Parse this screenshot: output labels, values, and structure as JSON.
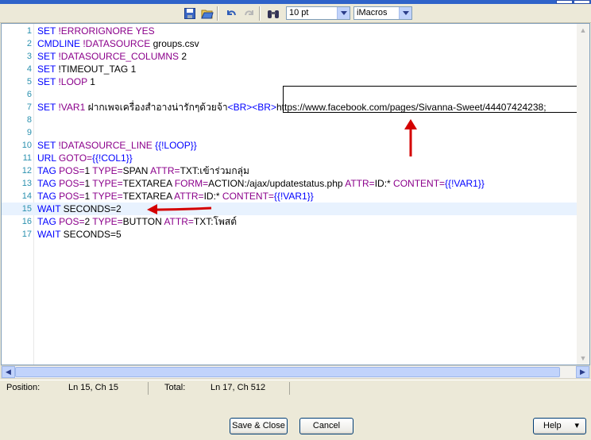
{
  "toolbar": {
    "font_size": "10 pt",
    "syntax": "iMacros"
  },
  "editor": {
    "lines": [
      {
        "n": "1",
        "parts": [
          [
            "kw",
            "SET "
          ],
          [
            "prm",
            "!ERRORIGNORE "
          ],
          [
            "prm",
            "YES"
          ]
        ]
      },
      {
        "n": "2",
        "parts": [
          [
            "kw",
            "CMDLINE "
          ],
          [
            "prm",
            "!DATASOURCE "
          ],
          [
            "tx",
            "groups.csv"
          ]
        ]
      },
      {
        "n": "3",
        "parts": [
          [
            "kw",
            "SET "
          ],
          [
            "prm",
            "!DATASOURCE_COLUMNS "
          ],
          [
            "tx",
            "2"
          ]
        ]
      },
      {
        "n": "4",
        "parts": [
          [
            "kw",
            "SET "
          ],
          [
            "tx",
            "!TIMEOUT_TAG 1"
          ]
        ]
      },
      {
        "n": "5",
        "parts": [
          [
            "kw",
            "SET "
          ],
          [
            "prm",
            "!LOOP "
          ],
          [
            "tx",
            "1"
          ]
        ]
      },
      {
        "n": "6",
        "parts": []
      },
      {
        "n": "7",
        "parts": [
          [
            "kw",
            "SET "
          ],
          [
            "prm",
            "!VAR1 "
          ],
          [
            "tx",
            "ฝากเพจเครื่องสำอางน่ารักๆด้วยจ้า"
          ],
          [
            "var",
            "<BR><BR>"
          ],
          [
            "tx",
            "https://www.facebook.com/pages/Sivanna-Sweet/44407424238;"
          ]
        ]
      },
      {
        "n": "8",
        "parts": []
      },
      {
        "n": "9",
        "parts": []
      },
      {
        "n": "10",
        "parts": [
          [
            "kw",
            "SET "
          ],
          [
            "prm",
            "!DATASOURCE_LINE "
          ],
          [
            "var",
            "{{!LOOP}}"
          ]
        ]
      },
      {
        "n": "11",
        "parts": [
          [
            "kw",
            "URL "
          ],
          [
            "prm",
            "GOTO="
          ],
          [
            "var",
            "{{!COL1}}"
          ]
        ]
      },
      {
        "n": "12",
        "parts": [
          [
            "kw",
            "TAG "
          ],
          [
            "prm",
            "POS="
          ],
          [
            "tx",
            "1 "
          ],
          [
            "prm",
            "TYPE="
          ],
          [
            "tx",
            "SPAN "
          ],
          [
            "prm",
            "ATTR="
          ],
          [
            "tx",
            "TXT:เข้าร่วมกลุ่ม"
          ]
        ]
      },
      {
        "n": "13",
        "parts": [
          [
            "kw",
            "TAG "
          ],
          [
            "prm",
            "POS="
          ],
          [
            "tx",
            "1 "
          ],
          [
            "prm",
            "TYPE="
          ],
          [
            "tx",
            "TEXTAREA "
          ],
          [
            "prm",
            "FORM="
          ],
          [
            "tx",
            "ACTION:/ajax/updatestatus.php "
          ],
          [
            "prm",
            "ATTR="
          ],
          [
            "tx",
            "ID:* "
          ],
          [
            "prm",
            "CONTENT="
          ],
          [
            "var",
            "{{!VAR1}}"
          ]
        ]
      },
      {
        "n": "14",
        "parts": [
          [
            "kw",
            "TAG "
          ],
          [
            "prm",
            "POS="
          ],
          [
            "tx",
            "1 "
          ],
          [
            "prm",
            "TYPE="
          ],
          [
            "tx",
            "TEXTAREA "
          ],
          [
            "prm",
            "ATTR="
          ],
          [
            "tx",
            "ID:* "
          ],
          [
            "prm",
            "CONTENT="
          ],
          [
            "var",
            "{{!VAR1}}"
          ]
        ]
      },
      {
        "n": "15",
        "parts": [
          [
            "kw",
            "WAIT "
          ],
          [
            "tx",
            "SECONDS=2"
          ]
        ]
      },
      {
        "n": "16",
        "parts": [
          [
            "kw",
            "TAG "
          ],
          [
            "prm",
            "POS="
          ],
          [
            "tx",
            "2 "
          ],
          [
            "prm",
            "TYPE="
          ],
          [
            "tx",
            "BUTTON "
          ],
          [
            "prm",
            "ATTR="
          ],
          [
            "tx",
            "TXT:โพสต์"
          ]
        ]
      },
      {
        "n": "17",
        "parts": [
          [
            "kw",
            "WAIT "
          ],
          [
            "tx",
            "SECONDS=5"
          ]
        ]
      }
    ],
    "current_line": "15"
  },
  "status": {
    "position_label": "Position:",
    "position_value": "Ln 15, Ch 15",
    "total_label": "Total:",
    "total_value": "Ln 17, Ch 512"
  },
  "buttons": {
    "save_close": "Save & Close",
    "cancel": "Cancel",
    "help": "Help"
  },
  "colors": {
    "keyword": "#0000ff",
    "param": "#8b008b",
    "annotation_arrow": "#d40000"
  }
}
